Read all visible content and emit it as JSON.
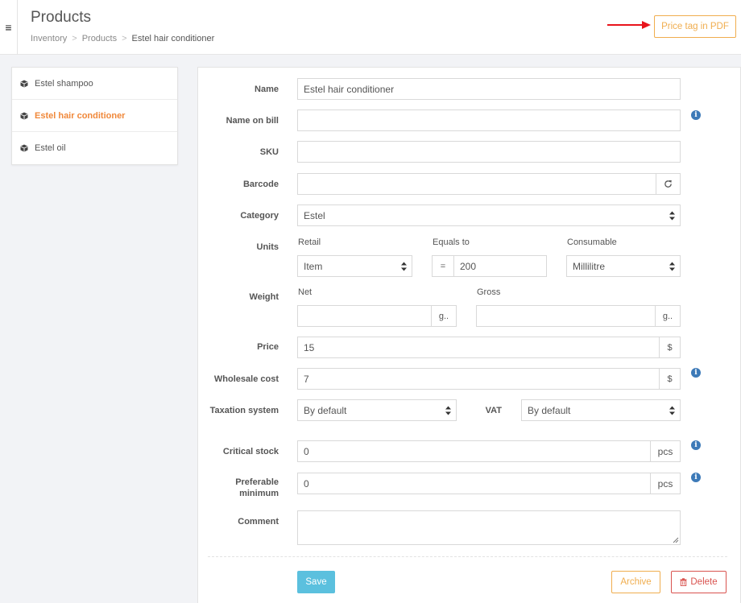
{
  "header": {
    "title": "Products",
    "breadcrumb": [
      "Inventory",
      "Products",
      "Estel hair conditioner"
    ],
    "price_tag_button": "Price tag in PDF"
  },
  "sidebar": {
    "items": [
      {
        "label": "Estel shampoo",
        "icon": "cube-icon",
        "active": false
      },
      {
        "label": "Estel hair conditioner",
        "icon": "cube-icon",
        "active": true
      },
      {
        "label": "Estel oil",
        "icon": "cube-icon",
        "active": false
      }
    ]
  },
  "form": {
    "name": {
      "label": "Name",
      "value": "Estel hair conditioner"
    },
    "name_on_bill": {
      "label": "Name on bill",
      "value": ""
    },
    "sku": {
      "label": "SKU",
      "value": ""
    },
    "barcode": {
      "label": "Barcode",
      "value": ""
    },
    "category": {
      "label": "Category",
      "value": "Estel"
    },
    "units": {
      "label": "Units",
      "retail_label": "Retail",
      "retail_value": "Item",
      "equals_label": "Equals to",
      "equals_sign": "=",
      "equals_value": "200",
      "consumable_label": "Consumable",
      "consumable_value": "Millilitre"
    },
    "weight": {
      "label": "Weight",
      "net_label": "Net",
      "net_value": "",
      "net_unit": "g..",
      "gross_label": "Gross",
      "gross_value": "",
      "gross_unit": "g.."
    },
    "price": {
      "label": "Price",
      "value": "15",
      "unit": "$"
    },
    "wholesale_cost": {
      "label": "Wholesale cost",
      "value": "7",
      "unit": "$"
    },
    "taxation": {
      "label": "Taxation system",
      "value": "By default"
    },
    "vat": {
      "label": "VAT",
      "value": "By default"
    },
    "critical_stock": {
      "label": "Critical stock",
      "value": "0",
      "unit": "pcs"
    },
    "preferable_minimum": {
      "label_1": "Preferable",
      "label_2": "minimum",
      "value": "0",
      "unit": "pcs"
    },
    "comment": {
      "label": "Comment",
      "value": ""
    }
  },
  "actions": {
    "save": "Save",
    "archive": "Archive",
    "delete": "Delete"
  },
  "colors": {
    "accent_orange": "#f0ad4e",
    "active_orange": "#f0883a",
    "save_blue": "#5bc0de",
    "delete_red": "#d9534f",
    "info_blue": "#3d7ab8"
  }
}
